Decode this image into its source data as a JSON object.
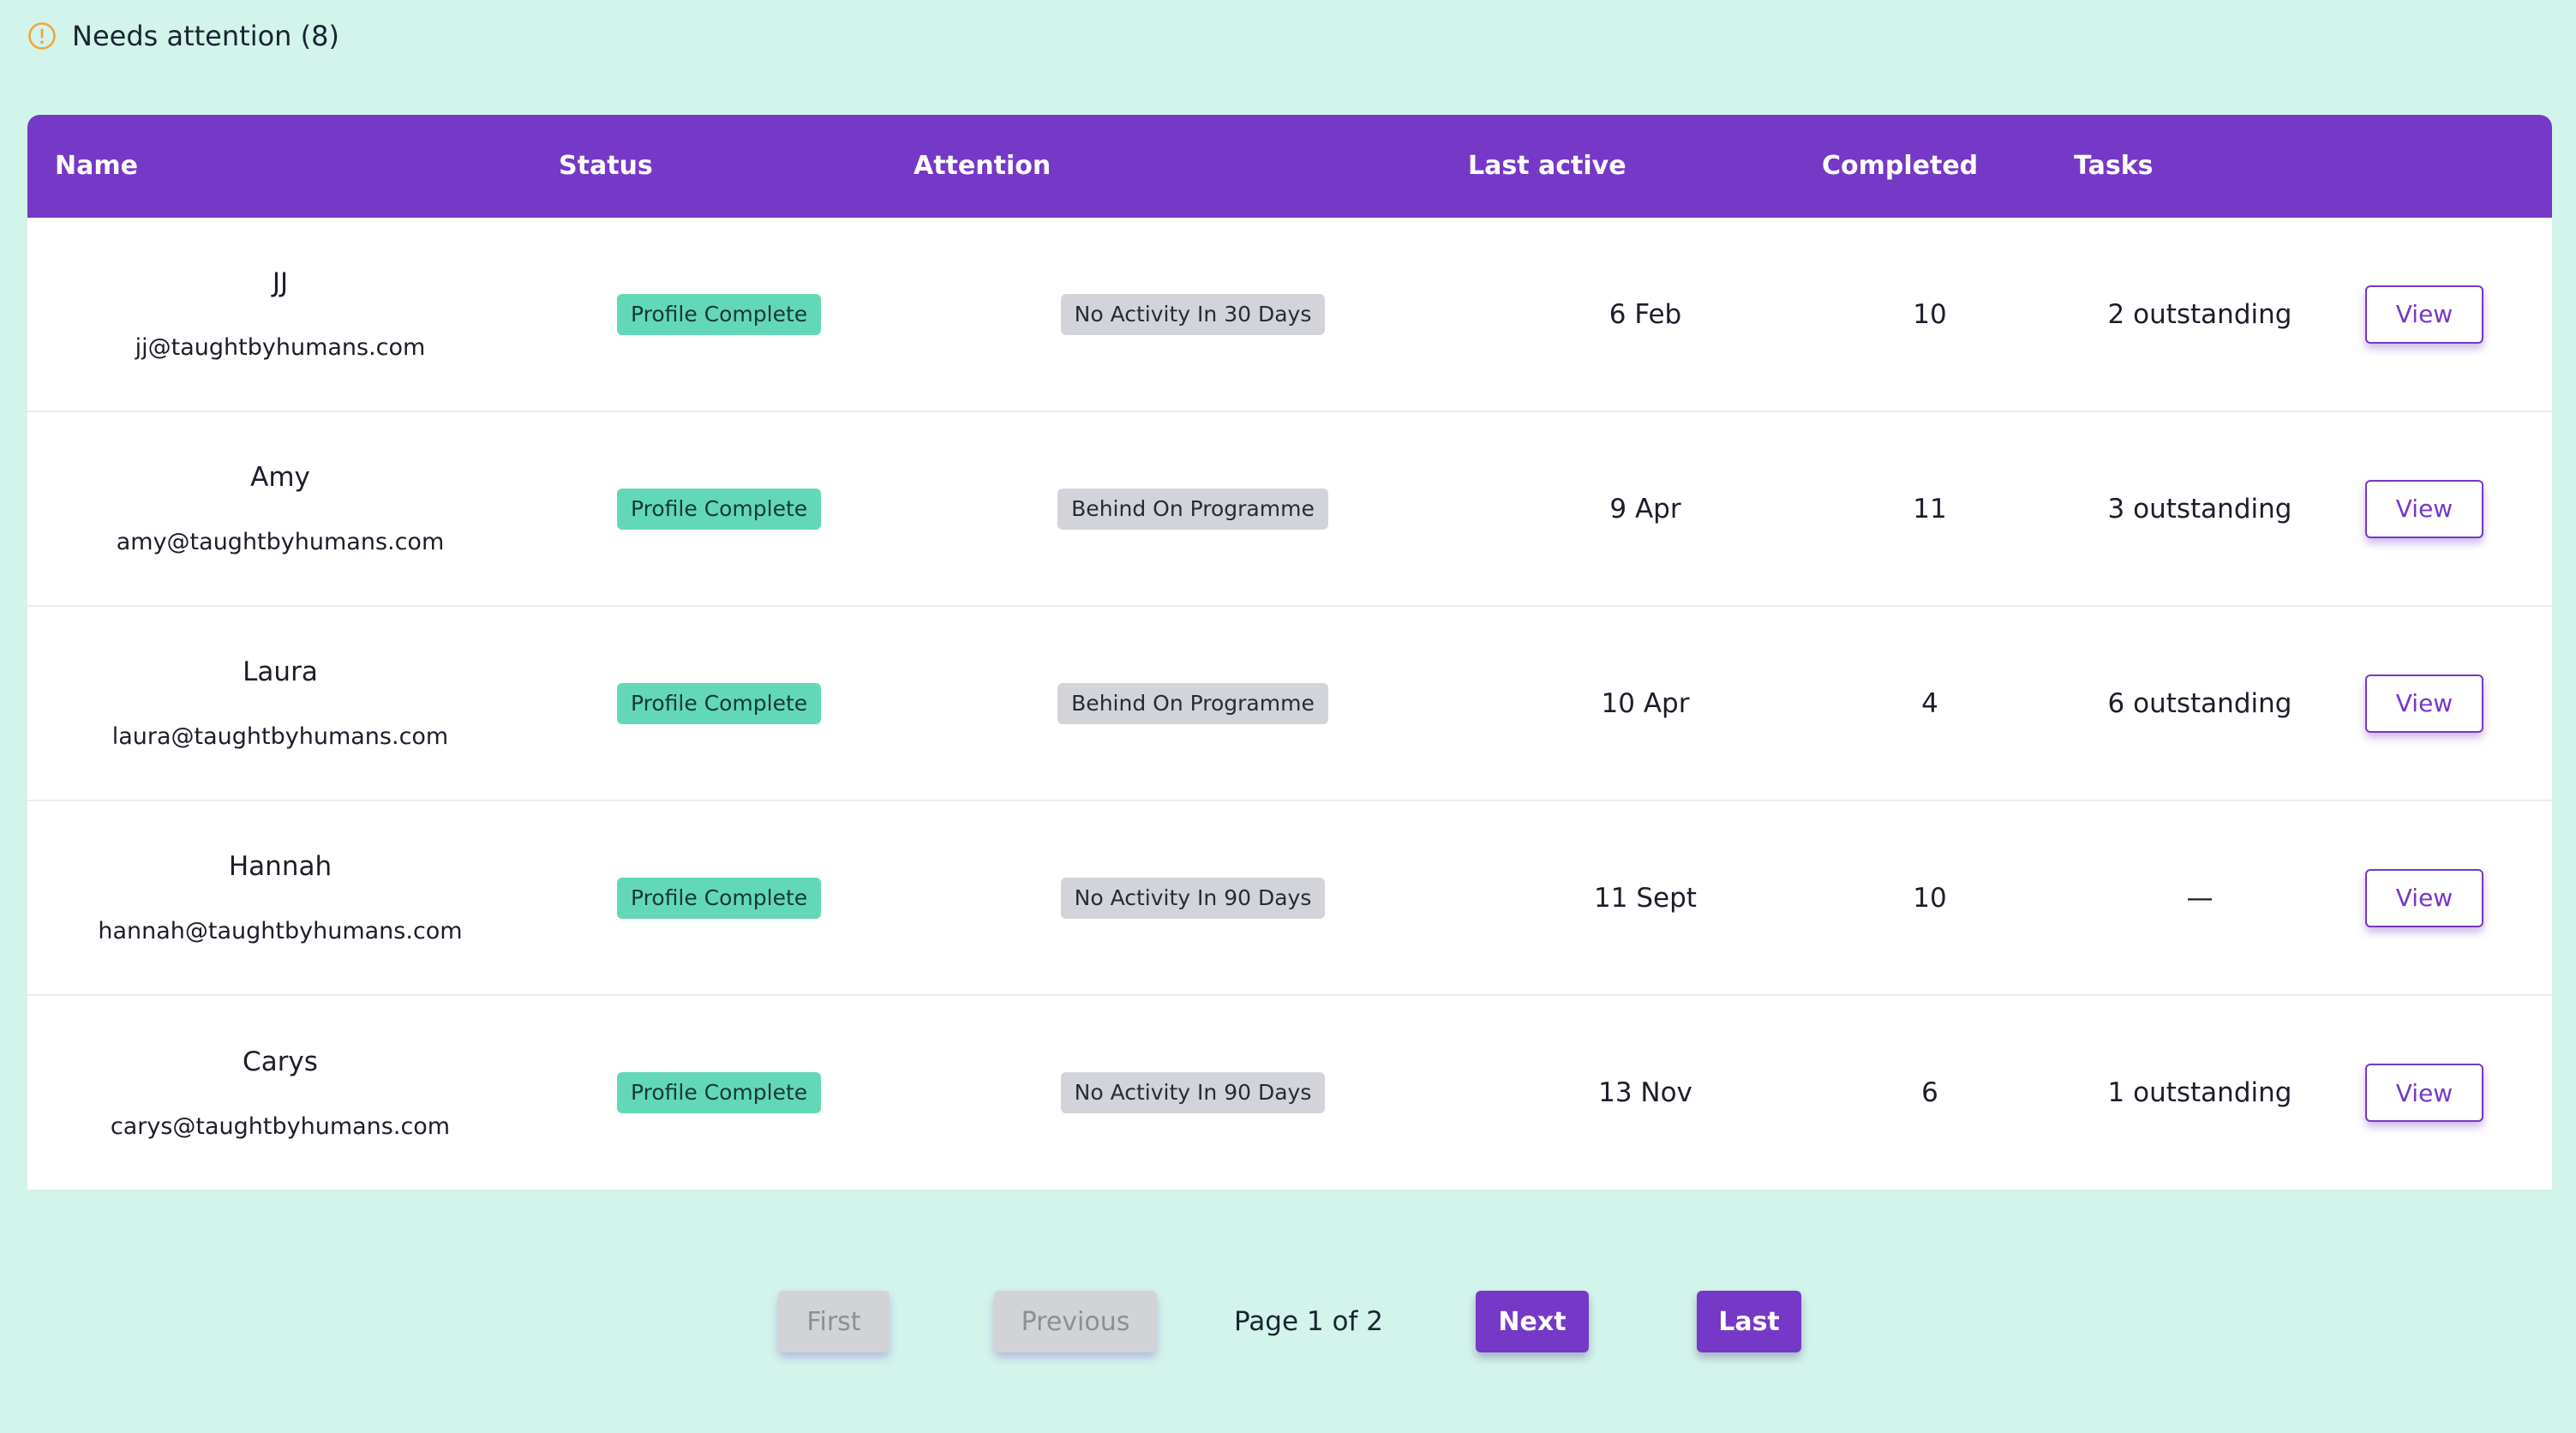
{
  "section": {
    "title": "Needs attention (8)",
    "icon": "warning-circle-icon",
    "icon_color": "#f0a63a"
  },
  "table": {
    "header_color": "#7638c6",
    "columns": [
      "Name",
      "Status",
      "Attention",
      "Last active",
      "Completed",
      "Tasks"
    ],
    "rows": [
      {
        "name": "JJ",
        "email": "jj@taughtbyhumans.com",
        "status": "Profile Complete",
        "attention": "No Activity In 30 Days",
        "last_active": "6 Feb",
        "completed": "10",
        "tasks": "2 outstanding",
        "action": "View"
      },
      {
        "name": "Amy",
        "email": "amy@taughtbyhumans.com",
        "status": "Profile Complete",
        "attention": "Behind On Programme",
        "last_active": "9 Apr",
        "completed": "11",
        "tasks": "3 outstanding",
        "action": "View"
      },
      {
        "name": "Laura",
        "email": "laura@taughtbyhumans.com",
        "status": "Profile Complete",
        "attention": "Behind On Programme",
        "last_active": "10 Apr",
        "completed": "4",
        "tasks": "6 outstanding",
        "action": "View"
      },
      {
        "name": "Hannah",
        "email": "hannah@taughtbyhumans.com",
        "status": "Profile Complete",
        "attention": "No Activity In 90 Days",
        "last_active": "11 Sept",
        "completed": "10",
        "tasks": "—",
        "action": "View"
      },
      {
        "name": "Carys",
        "email": "carys@taughtbyhumans.com",
        "status": "Profile Complete",
        "attention": "No Activity In 90 Days",
        "last_active": "13 Nov",
        "completed": "6",
        "tasks": "1 outstanding",
        "action": "View"
      }
    ]
  },
  "pagination": {
    "first": "First",
    "previous": "Previous",
    "page_info": "Page 1 of 2",
    "next": "Next",
    "last": "Last"
  },
  "colors": {
    "background": "#d2f4ea",
    "accent": "#7638c6",
    "status_badge": "#63d8b8",
    "attention_badge": "#d3d4d9"
  }
}
